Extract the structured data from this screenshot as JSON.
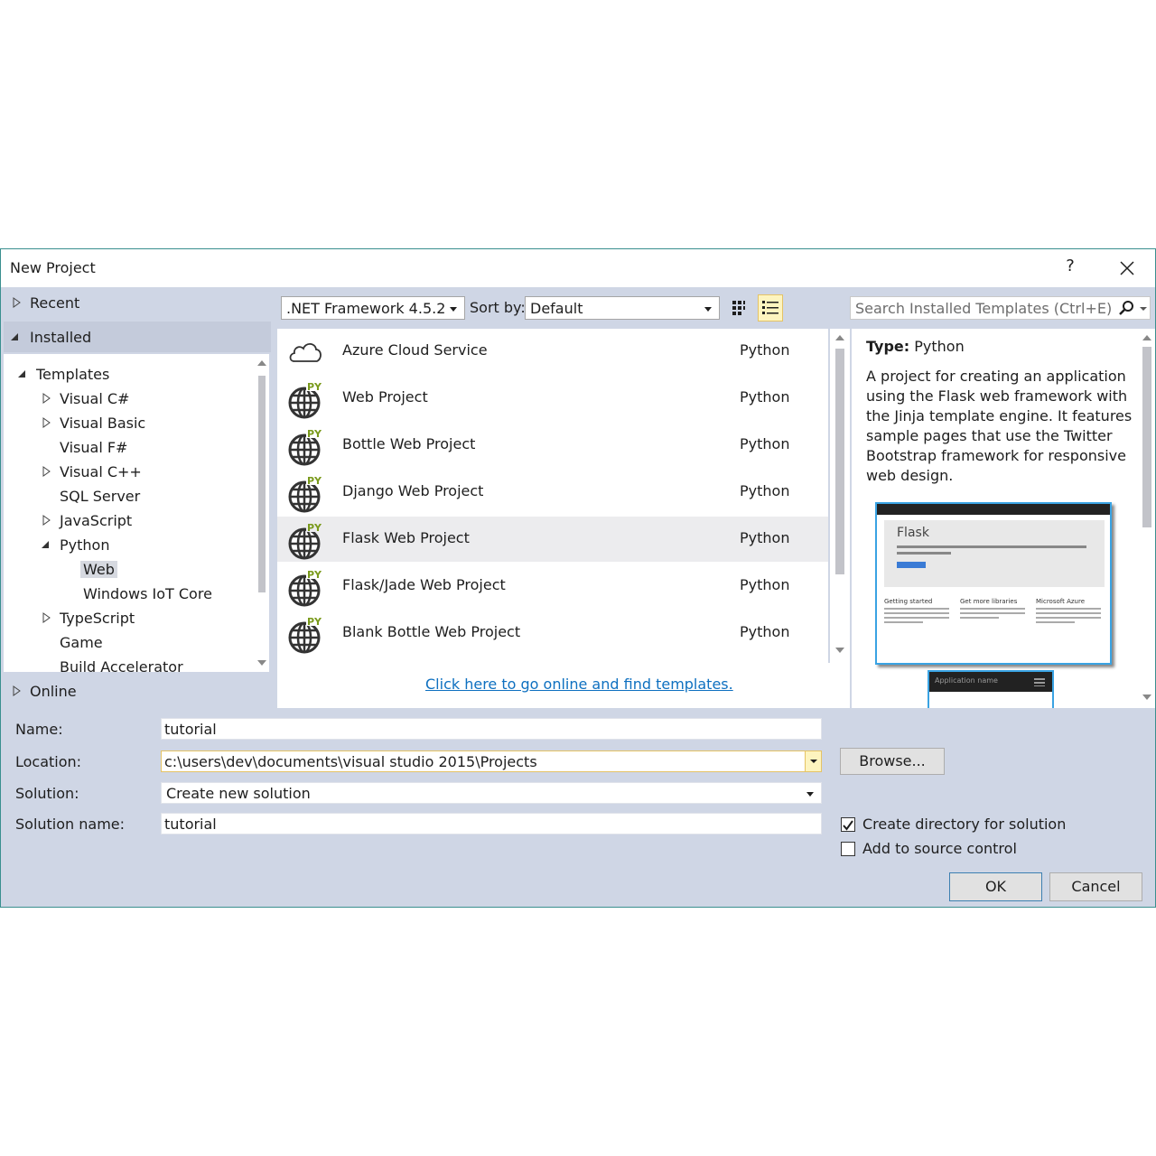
{
  "window": {
    "title": "New Project",
    "help": "?"
  },
  "nav": {
    "recent": "Recent",
    "installed": "Installed",
    "online": "Online",
    "tree": [
      {
        "label": "Templates"
      },
      {
        "label": "Visual C#"
      },
      {
        "label": "Visual Basic"
      },
      {
        "label": "Visual F#"
      },
      {
        "label": "Visual C++"
      },
      {
        "label": "SQL Server"
      },
      {
        "label": "JavaScript"
      },
      {
        "label": "Python"
      },
      {
        "label": "Web"
      },
      {
        "label": "Windows IoT Core"
      },
      {
        "label": "TypeScript"
      },
      {
        "label": "Game"
      },
      {
        "label": "Build Accelerator"
      }
    ]
  },
  "toolbar": {
    "framework": ".NET Framework 4.5.2",
    "sort_label": "Sort by:",
    "sort_value": "Default"
  },
  "search": {
    "placeholder": "Search Installed Templates (Ctrl+E)"
  },
  "templates": [
    {
      "name": "Azure Cloud Service",
      "language": "Python",
      "icon": "cloud-icon"
    },
    {
      "name": "Web Project",
      "language": "Python",
      "icon": "python-globe-icon"
    },
    {
      "name": "Bottle Web Project",
      "language": "Python",
      "icon": "python-globe-icon"
    },
    {
      "name": "Django Web Project",
      "language": "Python",
      "icon": "python-globe-icon"
    },
    {
      "name": "Flask Web Project",
      "language": "Python",
      "icon": "python-globe-icon",
      "selected": true
    },
    {
      "name": "Flask/Jade Web Project",
      "language": "Python",
      "icon": "python-globe-icon"
    },
    {
      "name": "Blank Bottle Web Project",
      "language": "Python",
      "icon": "python-globe-icon"
    }
  ],
  "icon_badge": "PY",
  "online_link": "Click here to go online and find templates.",
  "details": {
    "type_label": "Type:",
    "type_value": "Python",
    "description": "A project for creating an application using the Flask web framework with the Jinja template engine. It features sample pages that use the Twitter Bootstrap framework for responsive web design.",
    "preview": {
      "hero_title": "Flask",
      "columns": [
        "Getting started",
        "Get more libraries",
        "Microsoft Azure"
      ],
      "mobile_title": "Application name"
    }
  },
  "form": {
    "name_label": "Name:",
    "name_value": "tutorial",
    "location_label": "Location:",
    "location_value": "c:\\users\\dev\\documents\\visual studio 2015\\Projects",
    "solution_label": "Solution:",
    "solution_value": "Create new solution",
    "solution_name_label": "Solution name:",
    "solution_name_value": "tutorial",
    "browse": "Browse...",
    "create_dir_label": "Create directory for solution",
    "create_dir_checked": true,
    "source_control_label": "Add to source control",
    "source_control_checked": false,
    "ok": "OK",
    "cancel": "Cancel"
  },
  "colors": {
    "accent": "#0e70c0",
    "selection": "#c4cbdb",
    "dialog_bg": "#cfd6e5"
  }
}
